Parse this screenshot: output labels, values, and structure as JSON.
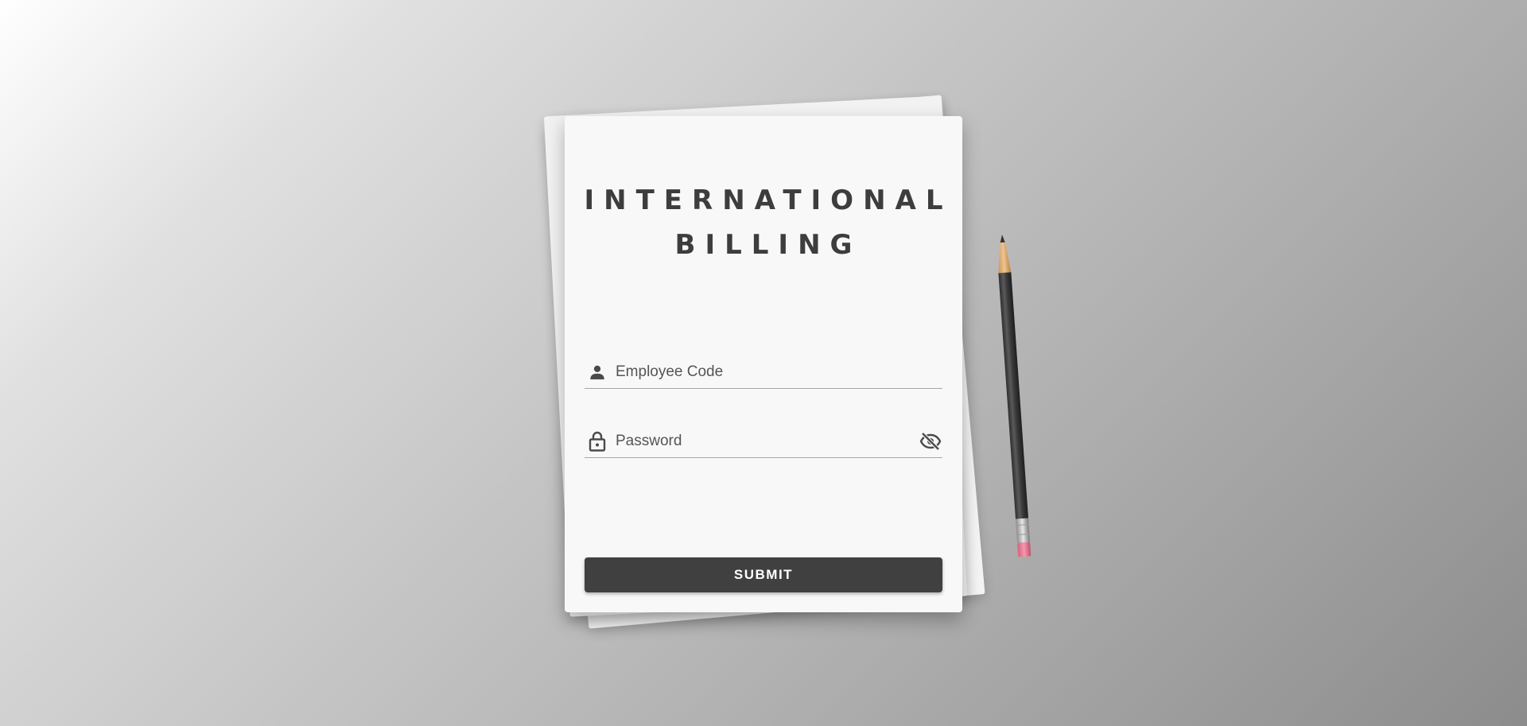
{
  "brand": {
    "title_line1": "INTERNATIONAL",
    "title_line2": "BILLING"
  },
  "form": {
    "employee_code": {
      "placeholder": "Employee Code",
      "icon": "person-icon"
    },
    "password": {
      "placeholder": "Password",
      "icon": "lock-icon",
      "toggle_icon": "eye-off-icon"
    },
    "submit_label": "SUBMIT"
  },
  "colors": {
    "ink": "#3d3d3d",
    "button": "#404040",
    "card": "#f8f8f8",
    "underline": "#a6a6a6"
  }
}
